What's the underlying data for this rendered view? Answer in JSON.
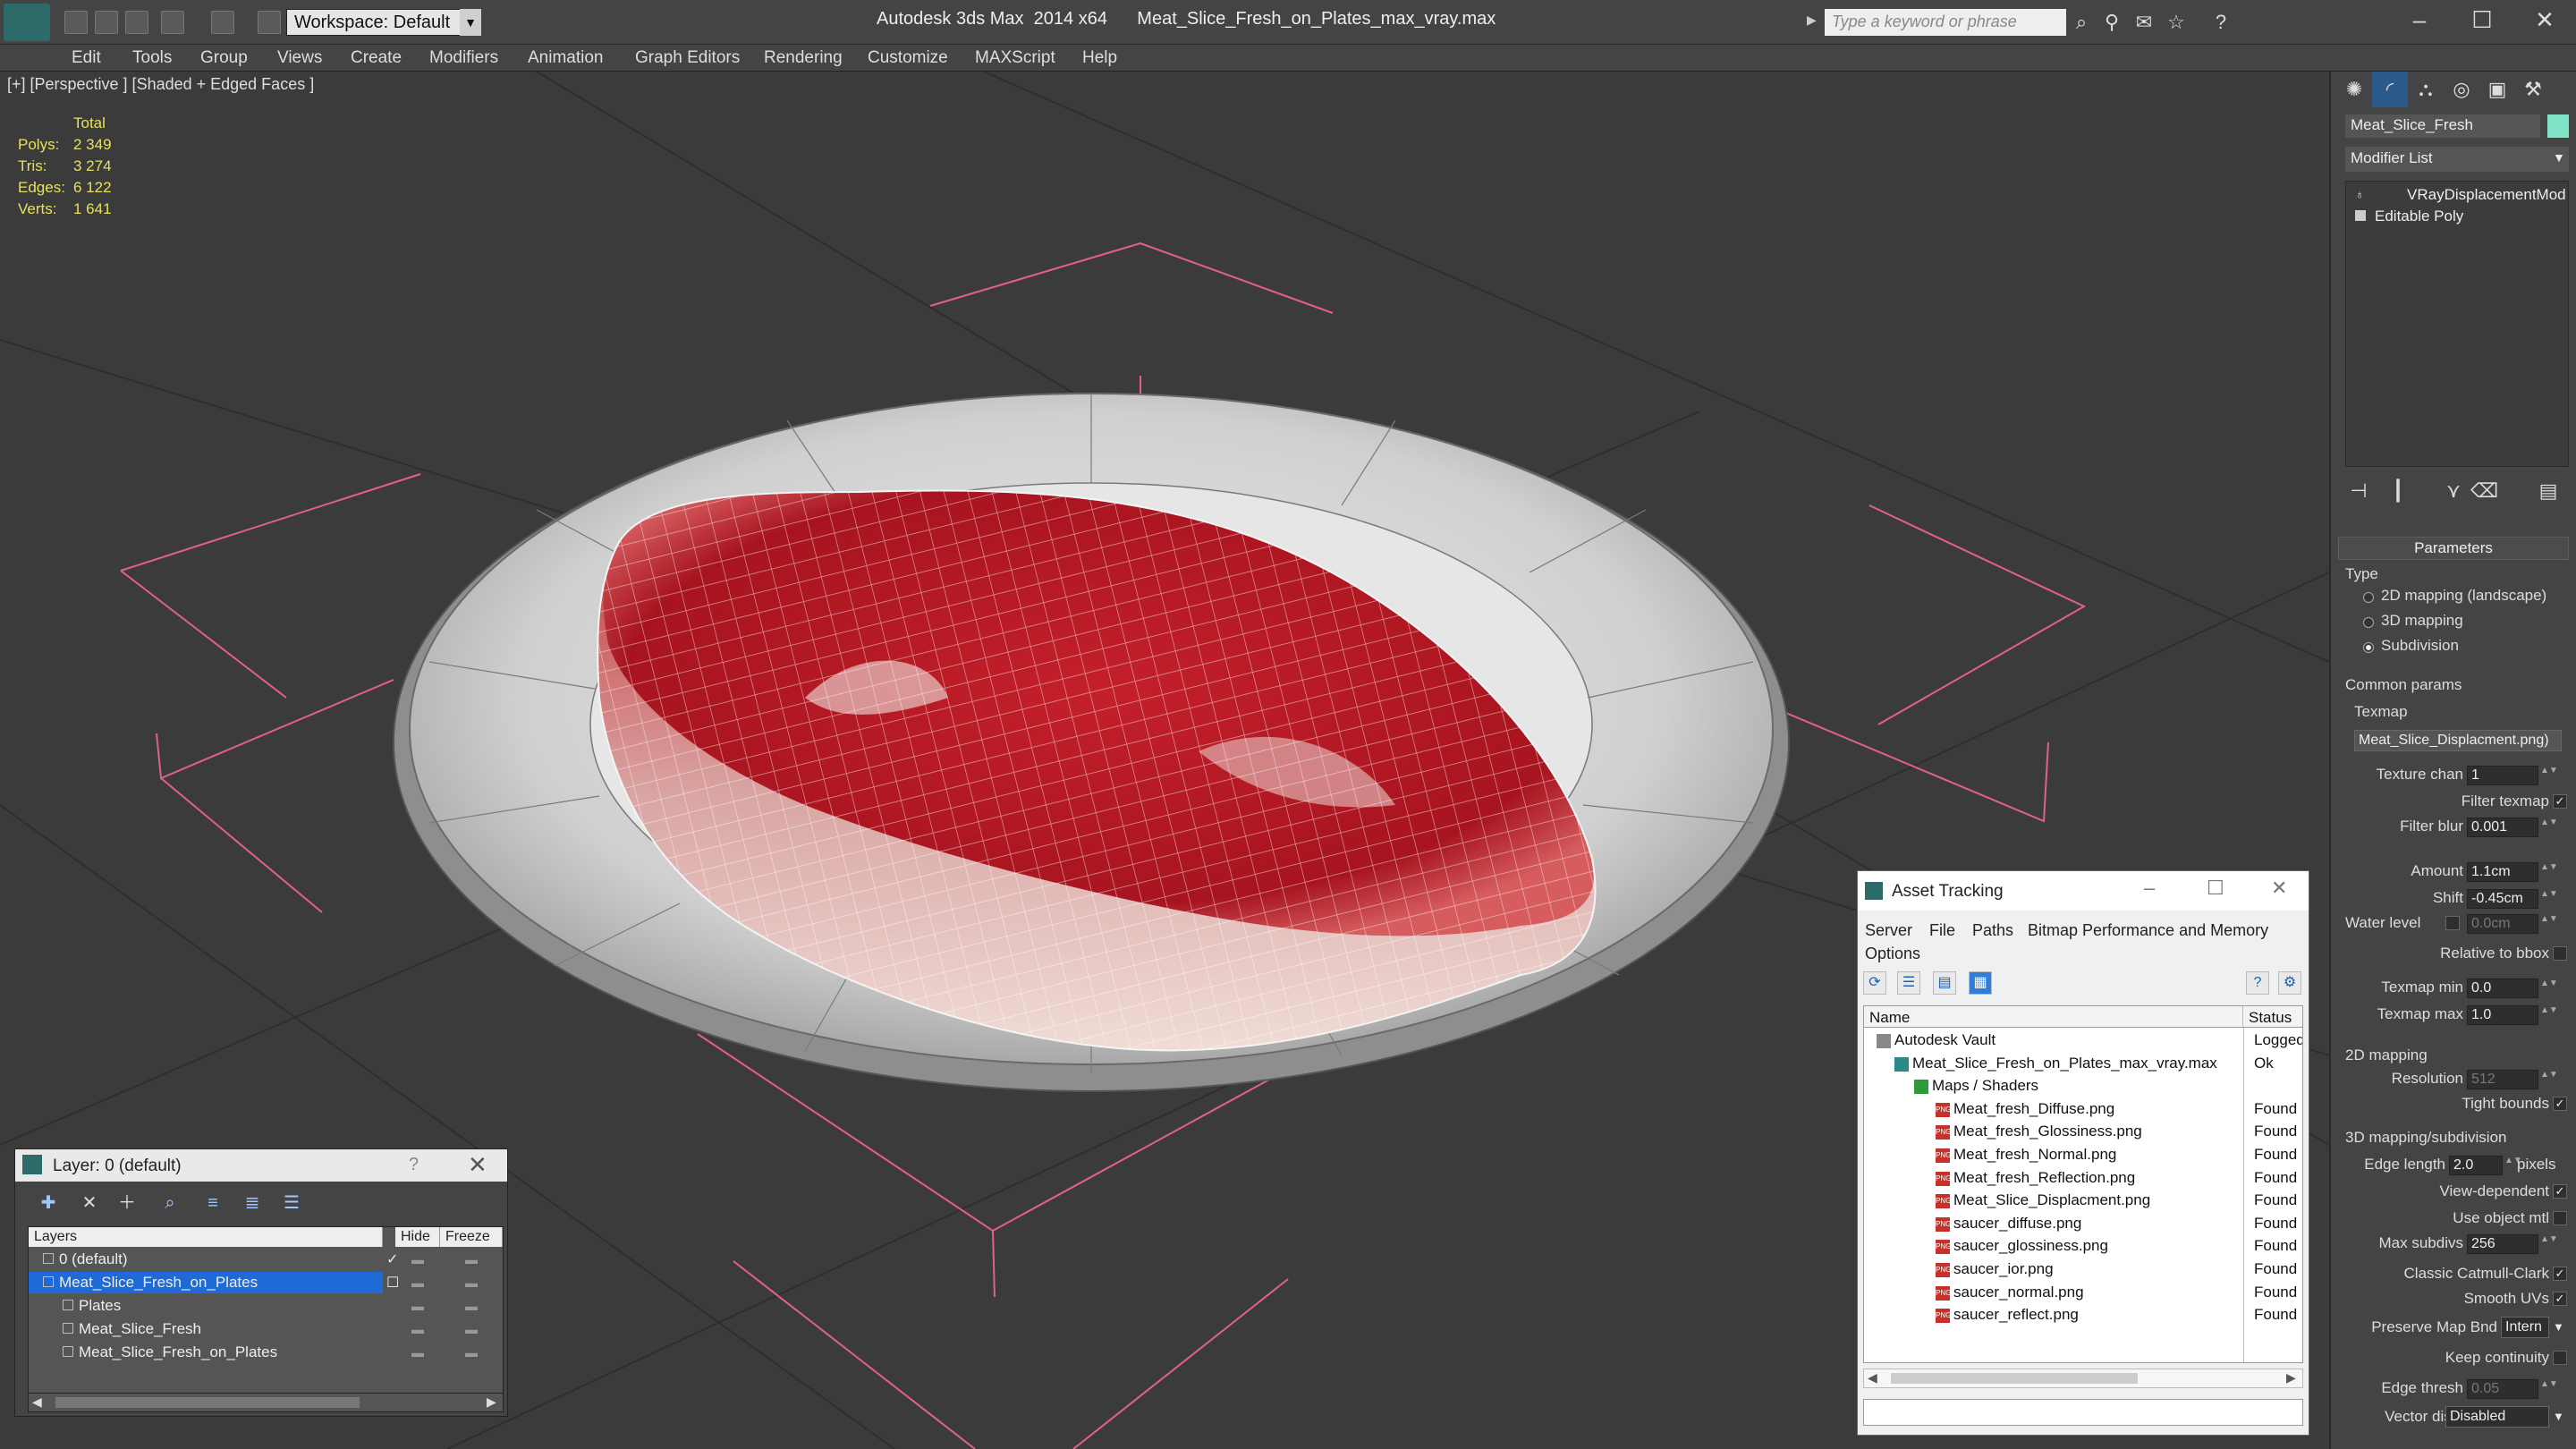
{
  "titlebar": {
    "workspace": "Workspace: Default",
    "app_title": "Autodesk 3ds Max  2014 x64",
    "file_title": "Meat_Slice_Fresh_on_Plates_max_vray.max",
    "search_placeholder": "Type a keyword or phrase"
  },
  "menu": [
    "Edit",
    "Tools",
    "Group",
    "Views",
    "Create",
    "Modifiers",
    "Animation",
    "Graph Editors",
    "Rendering",
    "Customize",
    "MAXScript",
    "Help"
  ],
  "viewport": {
    "label": "[+] [Perspective ] [Shaded + Edged Faces ]",
    "stats_header": "Total",
    "stats": [
      {
        "label": "Polys:",
        "value": "2 349"
      },
      {
        "label": "Tris:",
        "value": "3 274"
      },
      {
        "label": "Edges:",
        "value": "6 122"
      },
      {
        "label": "Verts:",
        "value": "1 641"
      }
    ]
  },
  "command_panel": {
    "object_name": "Meat_Slice_Fresh",
    "modifier_list": "Modifier List",
    "stack": [
      "VRayDisplacementMod",
      "Editable Poly"
    ],
    "rollout": "Parameters",
    "type_label": "Type",
    "type_options": [
      "2D mapping (landscape)",
      "3D mapping",
      "Subdivision"
    ],
    "type_selected": 2,
    "common_params": "Common params",
    "texmap_label": "Texmap",
    "texmap_value": "Meat_Slice_Displacment.png)",
    "texture_chan_label": "Texture chan",
    "texture_chan": "1",
    "filter_texmap_label": "Filter texmap",
    "filter_blur_label": "Filter blur",
    "filter_blur": "0.001",
    "amount_label": "Amount",
    "amount": "1.1cm",
    "shift_label": "Shift",
    "shift": "-0.45cm",
    "water_level_label": "Water level",
    "water_level": "0.0cm",
    "relative_bbox_label": "Relative to bbox",
    "texmap_min_label": "Texmap min",
    "texmap_min": "0.0",
    "texmap_max_label": "Texmap max",
    "texmap_max": "1.0",
    "sec_2d": "2D mapping",
    "resolution_label": "Resolution",
    "resolution": "512",
    "tight_bounds_label": "Tight bounds",
    "sec_3d": "3D mapping/subdivision",
    "edge_length_label": "Edge length",
    "edge_length": "2.0",
    "pixels_label": "pixels",
    "view_dependent_label": "View-dependent",
    "use_object_mtl_label": "Use object mtl",
    "max_subdivs_label": "Max subdivs",
    "max_subdivs": "256",
    "catmull_label": "Classic Catmull-Clark",
    "smooth_uvs_label": "Smooth UVs",
    "preserve_map_label": "Preserve Map Bnd",
    "preserve_map": "Intern",
    "keep_continuity_label": "Keep continuity",
    "edge_thresh_label": "Edge thresh",
    "edge_thresh": "0.05",
    "vector_displ_label": "Vector displ",
    "vector_displ": "Disabled"
  },
  "layer_panel": {
    "title": "Layer: 0 (default)",
    "help": "?",
    "col_layers": "Layers",
    "col_hide": "Hide",
    "col_freeze": "Freeze",
    "rows": [
      {
        "name": "0 (default)",
        "indent": 1,
        "checked": true,
        "selected": false
      },
      {
        "name": "Meat_Slice_Fresh_on_Plates",
        "indent": 1,
        "checked": false,
        "selected": true
      },
      {
        "name": "Plates",
        "indent": 2,
        "checked": false,
        "selected": false
      },
      {
        "name": "Meat_Slice_Fresh",
        "indent": 2,
        "checked": false,
        "selected": false
      },
      {
        "name": "Meat_Slice_Fresh_on_Plates",
        "indent": 2,
        "checked": false,
        "selected": false
      }
    ]
  },
  "asset_panel": {
    "title": "Asset Tracking",
    "menus": [
      "Server",
      "File",
      "Paths",
      "Bitmap Performance and Memory",
      "Options"
    ],
    "col_name": "Name",
    "col_status": "Status",
    "rows": [
      {
        "name": "Autodesk Vault",
        "status": "Logged",
        "indent": 0,
        "kind": "vault"
      },
      {
        "name": "Meat_Slice_Fresh_on_Plates_max_vray.max",
        "status": "Ok",
        "indent": 1,
        "kind": "max"
      },
      {
        "name": "Maps / Shaders",
        "status": "",
        "indent": 2,
        "kind": "folder"
      },
      {
        "name": "Meat_fresh_Diffuse.png",
        "status": "Found",
        "indent": 3,
        "kind": "png"
      },
      {
        "name": "Meat_fresh_Glossiness.png",
        "status": "Found",
        "indent": 3,
        "kind": "png"
      },
      {
        "name": "Meat_fresh_Normal.png",
        "status": "Found",
        "indent": 3,
        "kind": "png"
      },
      {
        "name": "Meat_fresh_Reflection.png",
        "status": "Found",
        "indent": 3,
        "kind": "png"
      },
      {
        "name": "Meat_Slice_Displacment.png",
        "status": "Found",
        "indent": 3,
        "kind": "png"
      },
      {
        "name": "saucer_diffuse.png",
        "status": "Found",
        "indent": 3,
        "kind": "png"
      },
      {
        "name": "saucer_glossiness.png",
        "status": "Found",
        "indent": 3,
        "kind": "png"
      },
      {
        "name": "saucer_ior.png",
        "status": "Found",
        "indent": 3,
        "kind": "png"
      },
      {
        "name": "saucer_normal.png",
        "status": "Found",
        "indent": 3,
        "kind": "png"
      },
      {
        "name": "saucer_reflect.png",
        "status": "Found",
        "indent": 3,
        "kind": "png"
      }
    ]
  }
}
